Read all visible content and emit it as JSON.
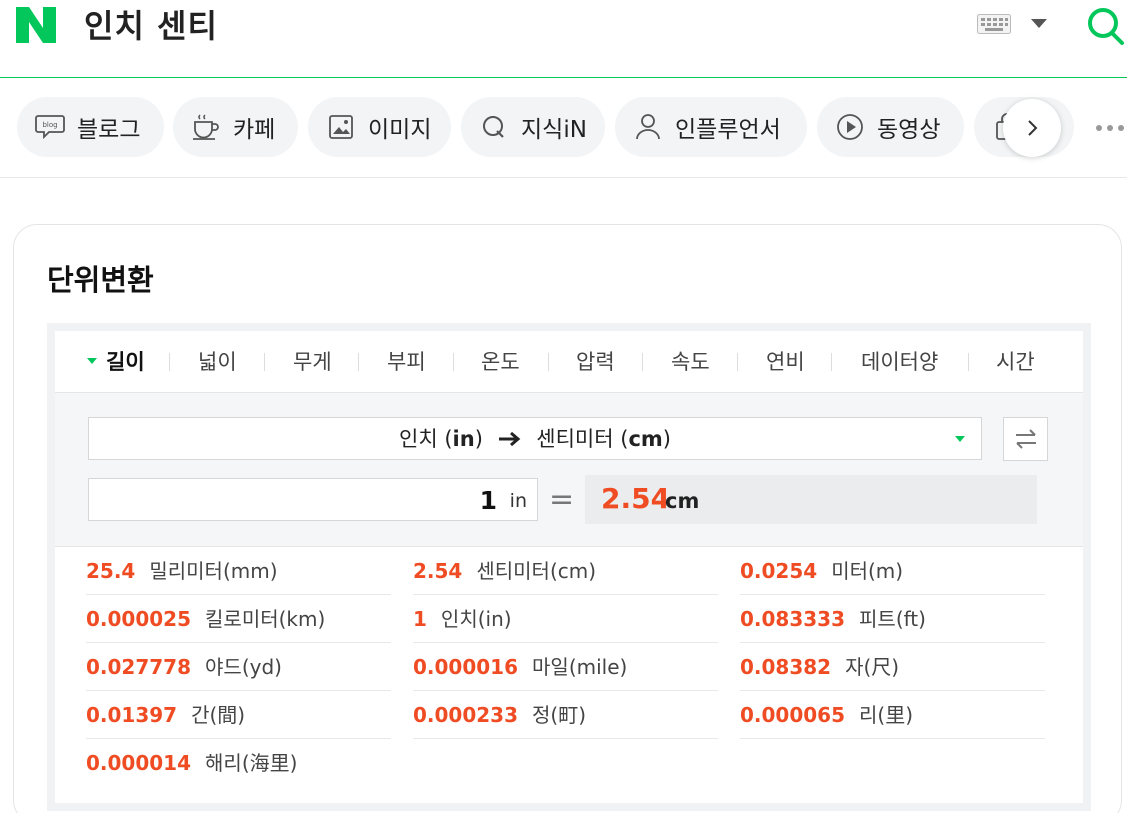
{
  "header": {
    "logo_letter": "N",
    "query": "인치 센티",
    "brand_color": "#03c75a"
  },
  "tabs": [
    {
      "label": "블로그",
      "icon": "blog-icon"
    },
    {
      "label": "카페",
      "icon": "cafe-cup-icon"
    },
    {
      "label": "이미지",
      "icon": "image-icon"
    },
    {
      "label": "지식iN",
      "icon": "knowledge-q-icon"
    },
    {
      "label": "인플루언서",
      "icon": "person-icon"
    },
    {
      "label": "동영상",
      "icon": "play-icon"
    },
    {
      "label": "",
      "icon": "shopping-bag-icon"
    }
  ],
  "card": {
    "title": "단위변환",
    "unit_tabs": [
      "길이",
      "넓이",
      "무게",
      "부피",
      "온도",
      "압력",
      "속도",
      "연비",
      "데이터양",
      "시간"
    ],
    "active_tab": "길이",
    "converter": {
      "from_unit": "인치",
      "from_abbr": "in",
      "to_unit": "센티미터",
      "to_abbr": "cm",
      "input_value": "1",
      "input_unit": "in",
      "equals": "=",
      "result_value": "2.54",
      "result_unit": "cm"
    },
    "results": [
      {
        "value": "25.4",
        "unit": "밀리미터(mm)"
      },
      {
        "value": "2.54",
        "unit": "센티미터(cm)"
      },
      {
        "value": "0.0254",
        "unit": "미터(m)"
      },
      {
        "value": "0.000025",
        "unit": "킬로미터(km)"
      },
      {
        "value": "1",
        "unit": "인치(in)"
      },
      {
        "value": "0.083333",
        "unit": "피트(ft)"
      },
      {
        "value": "0.027778",
        "unit": "야드(yd)"
      },
      {
        "value": "0.000016",
        "unit": "마일(mile)"
      },
      {
        "value": "0.08382",
        "unit": "자(尺)"
      },
      {
        "value": "0.01397",
        "unit": "간(間)"
      },
      {
        "value": "0.000233",
        "unit": "정(町)"
      },
      {
        "value": "0.000065",
        "unit": "리(里)"
      },
      {
        "value": "0.000014",
        "unit": "해리(海里)"
      }
    ],
    "accent_color": "#f04c23"
  }
}
